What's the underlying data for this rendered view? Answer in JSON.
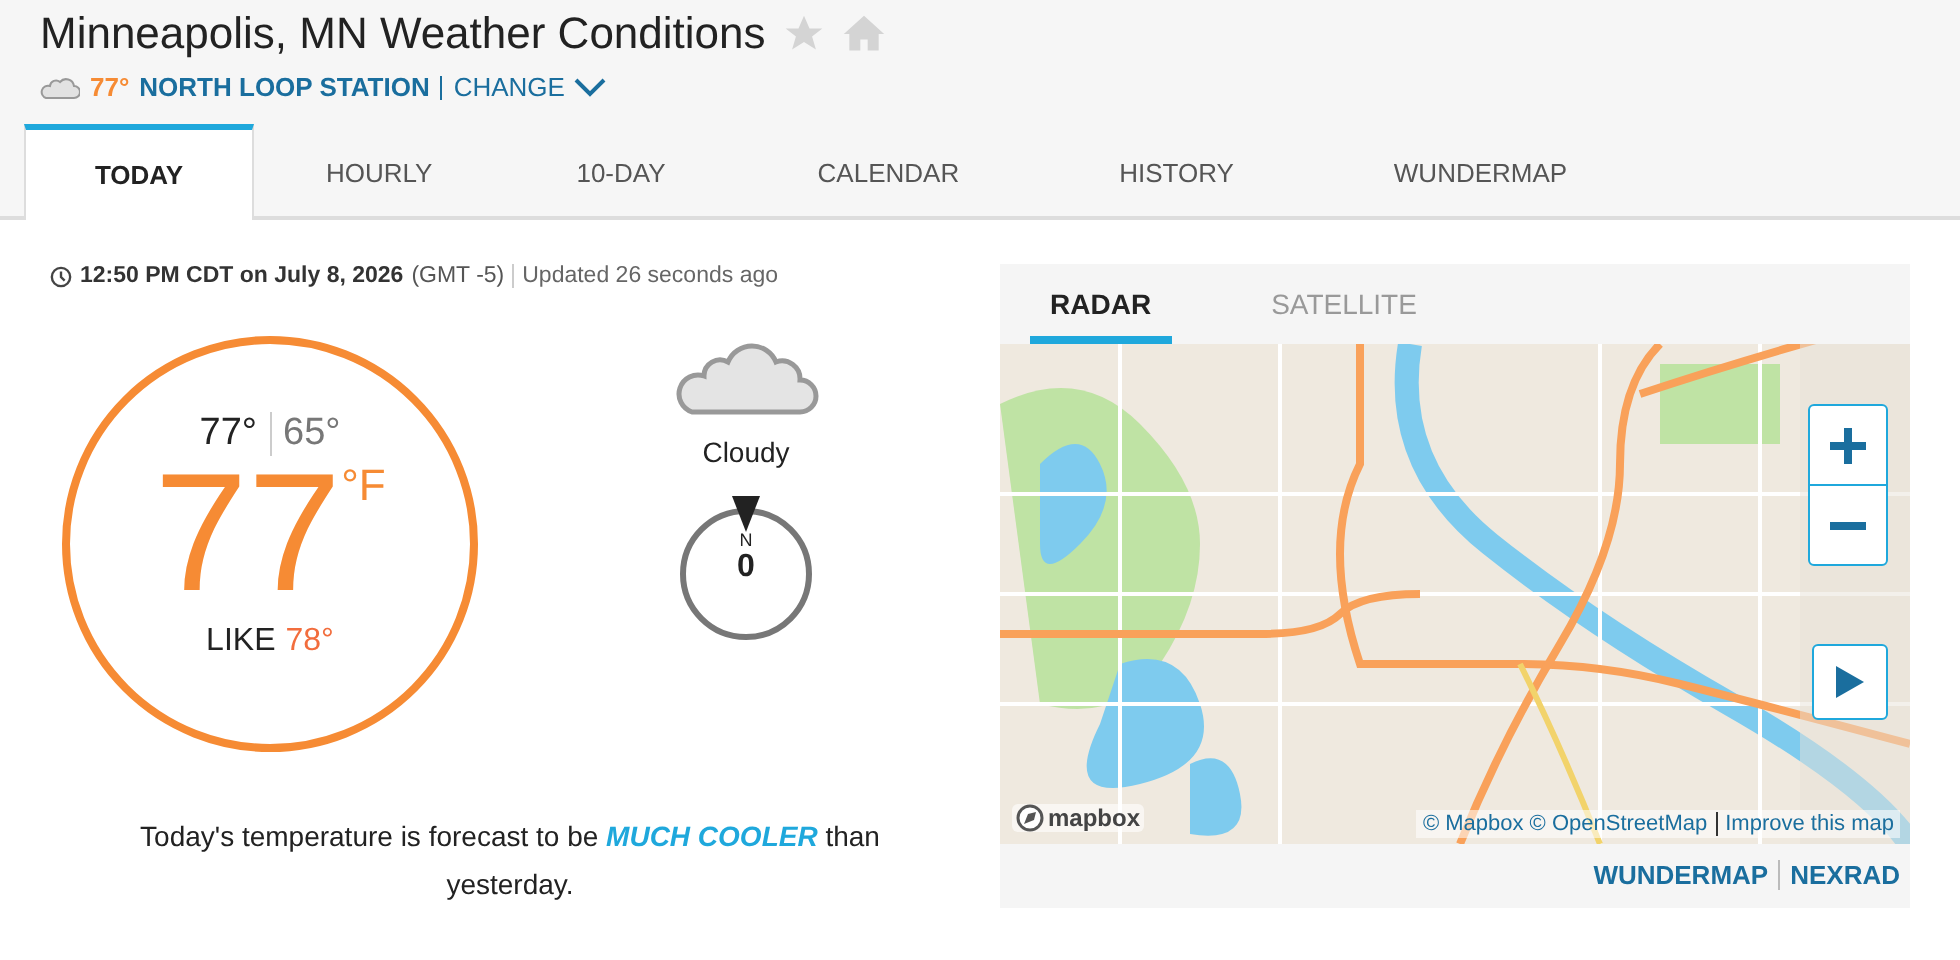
{
  "header": {
    "title": "Minneapolis, MN Weather Conditions",
    "station_temp": "77°",
    "station": "NORTH LOOP STATION",
    "change": "CHANGE"
  },
  "tabs": [
    {
      "label": "TODAY",
      "selected": true
    },
    {
      "label": "HOURLY",
      "selected": false
    },
    {
      "label": "10-DAY",
      "selected": false
    },
    {
      "label": "CALENDAR",
      "selected": false
    },
    {
      "label": "HISTORY",
      "selected": false
    },
    {
      "label": "WUNDERMAP",
      "selected": false
    }
  ],
  "current": {
    "time": "12:50 PM CDT on July 8, 2026",
    "timezone": "(GMT -5)",
    "updated": "Updated 26 seconds ago",
    "high": "77°",
    "low": "65°",
    "temp": "77",
    "unit": "°F",
    "feels_label": "LIKE",
    "feels": "78°",
    "condition": "Cloudy",
    "wind_dir": "N",
    "wind_speed": "0",
    "summary": "Today's temperature is forecast to be *MUCH COOLER* than yesterday."
  },
  "map": {
    "tabs": [
      {
        "label": "RADAR",
        "selected": true
      },
      {
        "label": "SATELLITE",
        "selected": false
      }
    ],
    "logo": "mapbox",
    "attribution": "© Mapbox © OpenStreetMap",
    "improve": "Improve this map",
    "links": [
      "WUNDERMAP",
      "NEXRAD"
    ]
  }
}
